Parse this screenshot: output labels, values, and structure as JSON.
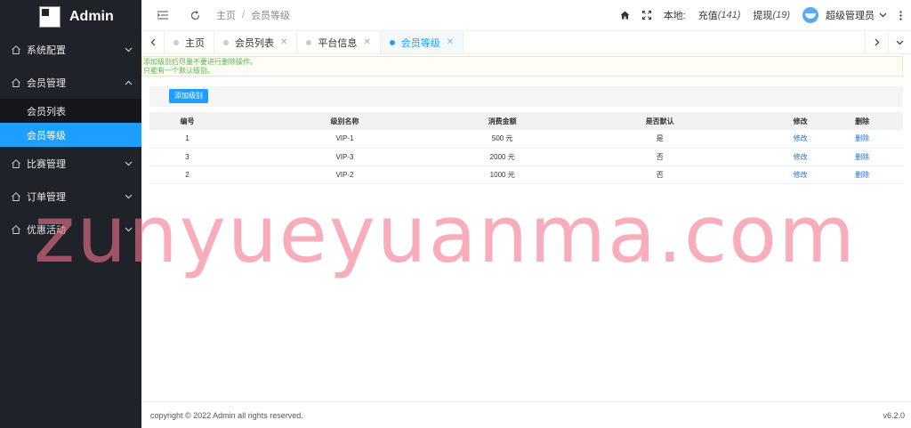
{
  "brand": {
    "name": "Admin"
  },
  "sidebar": {
    "items": [
      {
        "label": "系统配置",
        "chevron": "chevron-down"
      },
      {
        "label": "会员管理",
        "chevron": "chevron-up"
      },
      {
        "label": "比赛管理",
        "chevron": "chevron-down"
      },
      {
        "label": "订单管理",
        "chevron": "chevron-down"
      },
      {
        "label": "优惠活动",
        "chevron": "chevron-down"
      }
    ],
    "submenu": [
      {
        "label": "会员列表"
      },
      {
        "label": "会员等级"
      }
    ]
  },
  "header": {
    "breadcrumb": [
      "主页",
      "会员等级"
    ],
    "local_label": "本地:",
    "recharge_label": "充值",
    "recharge_count": "(141)",
    "withdraw_label": "提现",
    "withdraw_count": "(19)",
    "user_name": "超级管理员"
  },
  "tabs": [
    {
      "label": "主页"
    },
    {
      "label": "会员列表"
    },
    {
      "label": "平台信息"
    },
    {
      "label": "会员等级"
    }
  ],
  "notice": {
    "line1": "添加级别后尽量不要进行删除操作。",
    "line2": "只能有一个默认级别。"
  },
  "toolbar": {
    "add_label": "添加级别"
  },
  "table": {
    "headers": [
      "编号",
      "级别名称",
      "消费金额",
      "是否默认",
      "修改",
      "删除"
    ],
    "rows": [
      {
        "id": "1",
        "name": "VIP-1",
        "amount": "500 元",
        "default": "是",
        "edit": "修改",
        "delete": "删除"
      },
      {
        "id": "3",
        "name": "VIP-3",
        "amount": "2000 元",
        "default": "否",
        "edit": "修改",
        "delete": "删除"
      },
      {
        "id": "2",
        "name": "VIP-2",
        "amount": "1000 元",
        "default": "否",
        "edit": "修改",
        "delete": "删除"
      }
    ]
  },
  "watermark": "zunyueyuanma.com",
  "footer": {
    "copyright": "copyright © 2022 Admin all rights reserved.",
    "version": "v6.2.0"
  },
  "colors": {
    "sidebar_bg": "#20222a",
    "accent": "#1e9fff",
    "notice_text": "#52b74a",
    "link": "#1e6fd9"
  }
}
